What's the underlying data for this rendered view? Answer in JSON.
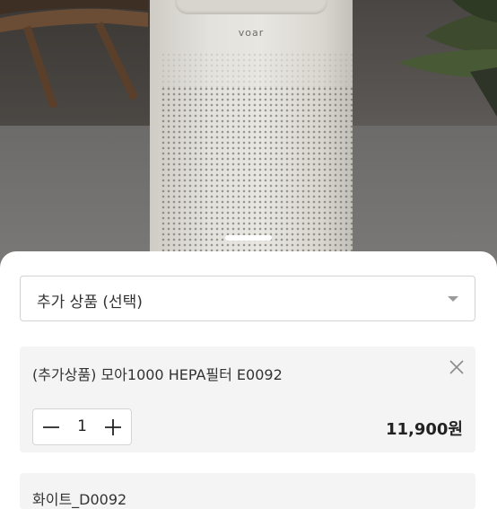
{
  "product_image": {
    "brand_text": "voar",
    "page_indicator": "active"
  },
  "option_select": {
    "label": "추가 상품 (선택)"
  },
  "selected_items": [
    {
      "name": "(추가상품) 모아1000 HEPA필터 E0092",
      "quantity": "1",
      "price": "11,900원",
      "minus_icon": "minus-icon",
      "plus_icon": "plus-icon",
      "remove_icon": "close-icon"
    },
    {
      "name": "화이트_D0092"
    }
  ],
  "colors": {
    "sheet_background": "#ffffff",
    "card_background": "#f4f4f4",
    "border": "#d3d3d3",
    "text": "#333333"
  }
}
